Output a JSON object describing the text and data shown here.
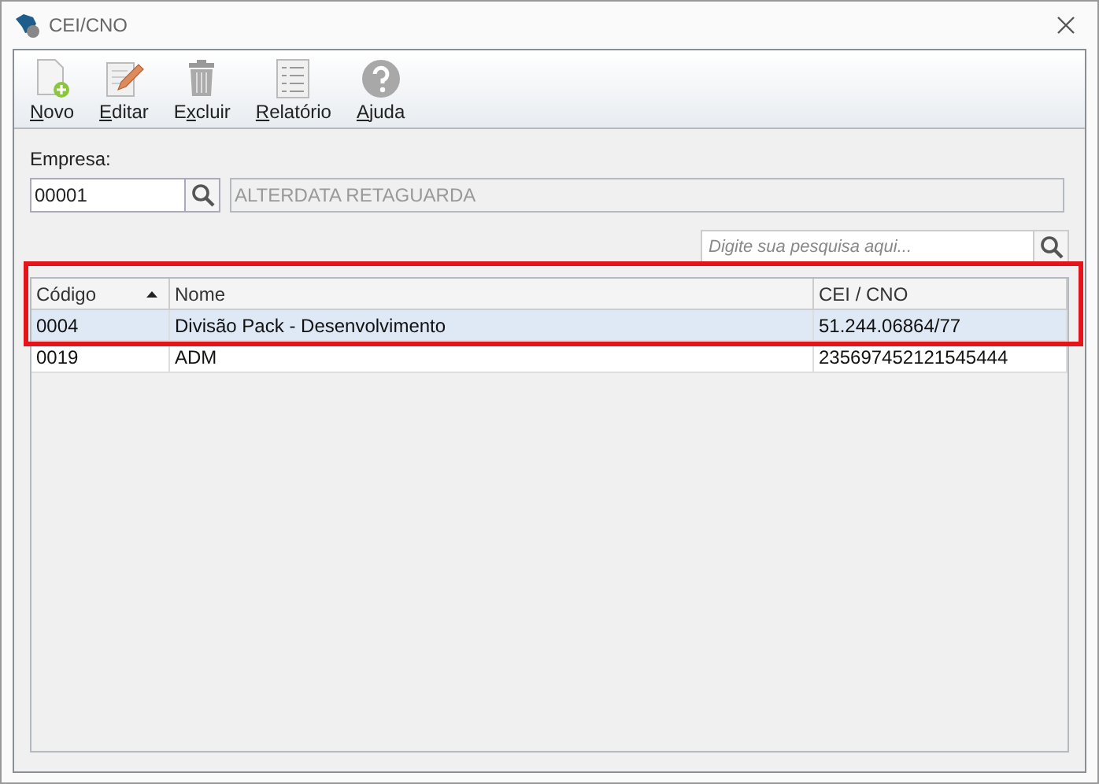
{
  "window": {
    "title": "CEI/CNO"
  },
  "toolbar": [
    {
      "kind": "new",
      "label_parts": [
        {
          "text": "N",
          "underlined": true
        },
        {
          "text": "ovo",
          "underlined": false
        }
      ],
      "disabled": false
    },
    {
      "kind": "edit",
      "label_parts": [
        {
          "text": "E",
          "underlined": true
        },
        {
          "text": "ditar",
          "underlined": false
        }
      ],
      "disabled": false
    },
    {
      "kind": "delete",
      "label_parts": [
        {
          "text": "E",
          "underlined": false
        },
        {
          "text": "x",
          "underlined": true
        },
        {
          "text": "cluir",
          "underlined": false
        }
      ],
      "disabled": false
    },
    {
      "kind": "report",
      "label_parts": [
        {
          "text": "R",
          "underlined": true
        },
        {
          "text": "elatório",
          "underlined": false
        }
      ],
      "disabled": false
    },
    {
      "kind": "help",
      "label_parts": [
        {
          "text": "A",
          "underlined": true
        },
        {
          "text": "juda",
          "underlined": false
        }
      ],
      "disabled": false
    }
  ],
  "empresa": {
    "label": "Empresa:",
    "value": "00001",
    "name": "ALTERDATA RETAGUARDA"
  },
  "search": {
    "placeholder": "Digite sua pesquisa aqui..."
  },
  "table": {
    "columns": [
      {
        "label": "Código",
        "sorted": true
      },
      {
        "label": "Nome",
        "sorted": false
      },
      {
        "label": "CEI / CNO",
        "sorted": false
      }
    ],
    "rows": [
      {
        "cells": [
          "0004",
          "Divisão Pack - Desenvolvimento",
          "51.244.06864/77"
        ],
        "selected": true
      },
      {
        "cells": [
          "0019",
          "ADM",
          "235697452121545444"
        ],
        "selected": false
      }
    ]
  }
}
